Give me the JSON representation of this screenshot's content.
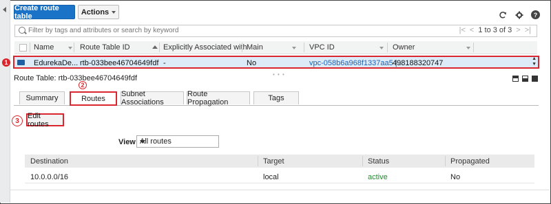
{
  "toolbar": {
    "create_label": "Create route table",
    "actions_label": "Actions"
  },
  "icons": {
    "refresh": "refresh-icon",
    "settings": "gear-icon",
    "help": "help-icon"
  },
  "search": {
    "placeholder": "Filter by tags and attributes or search by keyword"
  },
  "pager": {
    "range": "1 to 3 of 3"
  },
  "table": {
    "columns": [
      "Name",
      "Route Table ID",
      "Explicitly Associated with",
      "Main",
      "VPC ID",
      "Owner"
    ],
    "row": {
      "name": "EdurekaDe...",
      "route_table_id": "rtb-033bee46704649fdf",
      "explicit": "-",
      "main": "No",
      "vpc_id": "vpc-058b6a968f1337aa5 |...",
      "owner": "498188320747"
    }
  },
  "badges": {
    "one": "1",
    "two": "2",
    "three": "3"
  },
  "detail": {
    "label": "Route Table: rtb-033bee46704649fdf",
    "tabs": [
      "Summary",
      "Routes",
      "Subnet Associations",
      "Route Propagation",
      "Tags"
    ],
    "active_tab": "Routes",
    "edit_routes_label": "Edit routes",
    "view_label": "View",
    "view_selected": "All routes"
  },
  "routes": {
    "columns": [
      "Destination",
      "Target",
      "Status",
      "Propagated"
    ],
    "rows": [
      {
        "destination": "10.0.0.0/16",
        "target": "local",
        "status": "active",
        "propagated": "No"
      }
    ]
  },
  "colors": {
    "primary": "#1a73c7",
    "highlight": "#d9262e",
    "selected_row": "#ddeaf7",
    "active_status": "#1e8c2b",
    "link": "#1a64b4"
  }
}
